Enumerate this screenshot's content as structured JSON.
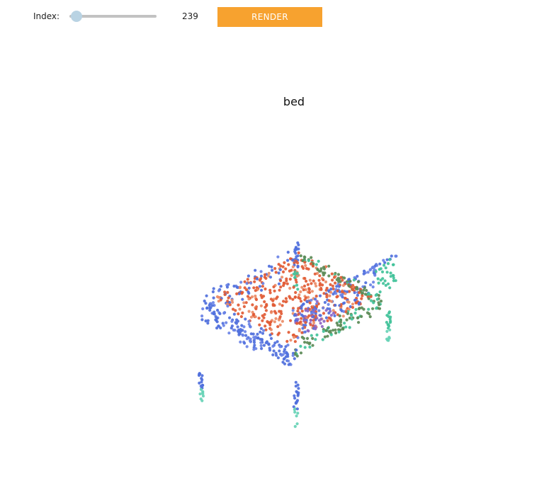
{
  "controls": {
    "index_label": "Index:",
    "index_value": "239",
    "slider_fraction": 0.06,
    "render_label": "RENDER"
  },
  "plot": {
    "title": "bed",
    "palette": {
      "blue": "#4f6fdc",
      "lightblue": "#6a83e6",
      "teal": "#42c29a",
      "mint": "#67d2b6",
      "orange": "#e15a34",
      "salmon": "#ec8c67",
      "purple": "#8e66c4",
      "olive": "#5b8a56"
    }
  }
}
